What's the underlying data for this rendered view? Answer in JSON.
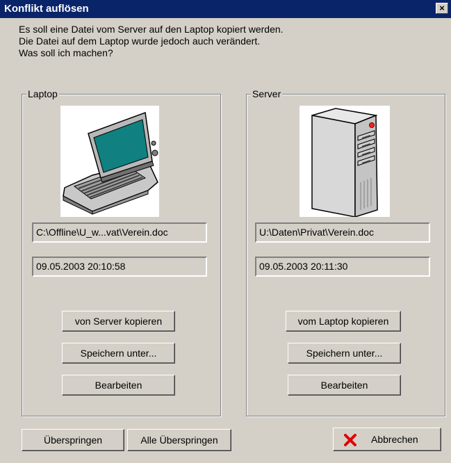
{
  "window": {
    "title": "Konflikt auflösen",
    "close_glyph": "×"
  },
  "message": {
    "line1": "Es soll eine Datei vom Server auf den Laptop kopiert werden.",
    "line2": "Die Datei auf dem Laptop wurde jedoch auch verändert.",
    "line3": "Was soll ich machen?"
  },
  "laptop": {
    "group_label": "Laptop",
    "image_icon": "laptop-icon",
    "path": "C:\\Offline\\U_w...vat\\Verein.doc",
    "timestamp": "09.05.2003 20:10:58",
    "copy_button": "von Server kopieren",
    "save_as_button": "Speichern unter...",
    "edit_button": "Bearbeiten"
  },
  "server": {
    "group_label": "Server",
    "image_icon": "server-tower-icon",
    "path": "U:\\Daten\\Privat\\Verein.doc",
    "timestamp": "09.05.2003 20:11:30",
    "copy_button": "vom Laptop kopieren",
    "save_as_button": "Speichern unter...",
    "edit_button": "Bearbeiten"
  },
  "footer": {
    "skip_button": "Überspringen",
    "skip_all_button": "Alle Überspringen",
    "cancel_button": "Abbrechen",
    "cancel_icon": "red-x-icon"
  },
  "colors": {
    "titlebar": "#0a246a",
    "face": "#d4d0c8",
    "laptop_screen": "#108080",
    "cancel_x": "#e00000"
  }
}
